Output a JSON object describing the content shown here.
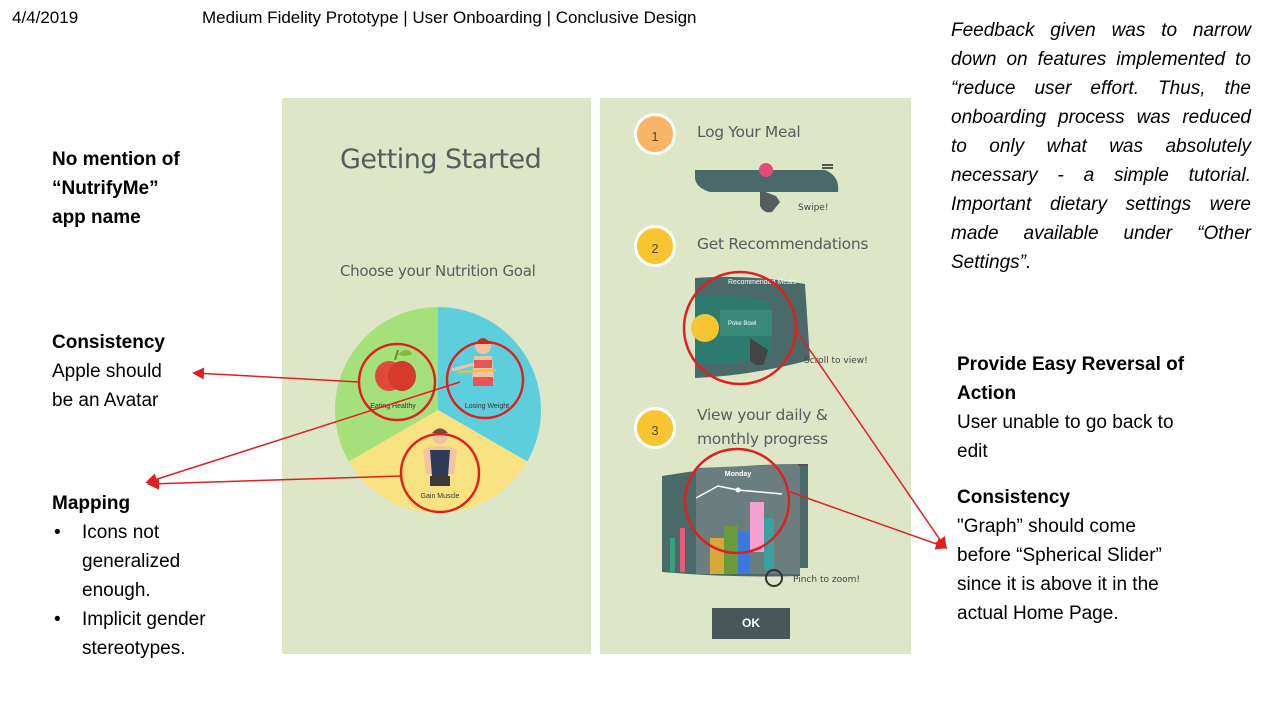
{
  "header": {
    "date": "4/4/2019",
    "title": "Medium Fidelity Prototype | User Onboarding | Conclusive Design"
  },
  "notes": {
    "app_name": {
      "line1": "No mention of",
      "line2": "“NutrifyMe”",
      "line3": "app name"
    },
    "consistency_left": {
      "title": "Consistency",
      "line1": "Apple should",
      "line2": "be an Avatar"
    },
    "mapping": {
      "title": "Mapping",
      "b1_line1": "Icons not",
      "b1_line2": "generalized",
      "b1_line3": "enough.",
      "b2_line1": "Implicit gender",
      "b2_line2": "stereotypes."
    },
    "feedback": "Feedback given was to narrow down on features implemented to “reduce user effort. Thus, the onboarding process was reduced to only what was absolutely necessary - a simple tutorial. Important dietary settings were made available under “Other Settings”.",
    "reversal": {
      "title_line1": "Provide Easy Reversal of",
      "title_line2": "Action",
      "line1": "User unable to go back to",
      "line2": "edit"
    },
    "consistency_right": {
      "title": "Consistency",
      "line1": "\"Graph” should come",
      "line2": "before “Spherical Slider”",
      "line3": "since it is above it in the",
      "line4": "actual Home Page."
    }
  },
  "left_screen": {
    "title": "Getting Started",
    "subtitle": "Choose your Nutrition Goal",
    "segments": [
      "Eating Healthy",
      "Losing Weight",
      "Gain Muscle"
    ],
    "colors": {
      "green": "#a6e07a",
      "cyan": "#5dcfdc",
      "yellow": "#f8e282",
      "bg": "#dde6c7"
    }
  },
  "right_screen": {
    "steps": [
      {
        "number": "1",
        "title": "Log Your Meal",
        "hint": "Swipe!"
      },
      {
        "number": "2",
        "title": "Get Recommendations",
        "hint": "Scroll to view!",
        "card_header": "Recommended Meals",
        "card_item": "Poke Bowl"
      },
      {
        "number": "3",
        "title_line1": "View your daily &",
        "title_line2": "monthly progress",
        "hint": "Pinch to zoom!",
        "graph_label": "Monday"
      }
    ],
    "ok_label": "OK",
    "colors": {
      "step1": "#f9b467",
      "step2": "#f6c531",
      "step3": "#f6c531",
      "dark": "#4a5759"
    }
  },
  "annotation_color": "#e02020"
}
